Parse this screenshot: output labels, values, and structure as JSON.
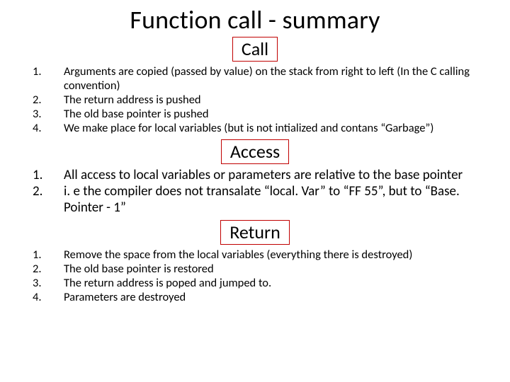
{
  "title": "Function call - summary",
  "sections": [
    {
      "label": "Call",
      "size": "small",
      "items": [
        "Arguments are copied (passed by value) on the stack from right to left (In the C calling convention)",
        "The return address is pushed",
        "The old base pointer is pushed",
        "We make place for local variables (but is not intialized and contans “Garbage”)"
      ]
    },
    {
      "label": "Access",
      "size": "med",
      "items": [
        "All access to local variables or parameters are relative to the base pointer",
        "i. e the compiler does not transalate “local. Var” to “FF 55”, but to “Base. Pointer  - 1”"
      ]
    },
    {
      "label": "Return",
      "size": "small",
      "items": [
        "Remove the space from the local variables (everything there is destroyed)",
        "The old base pointer is restored",
        "The return address is poped and jumped to.",
        "Parameters are destroyed"
      ]
    }
  ]
}
